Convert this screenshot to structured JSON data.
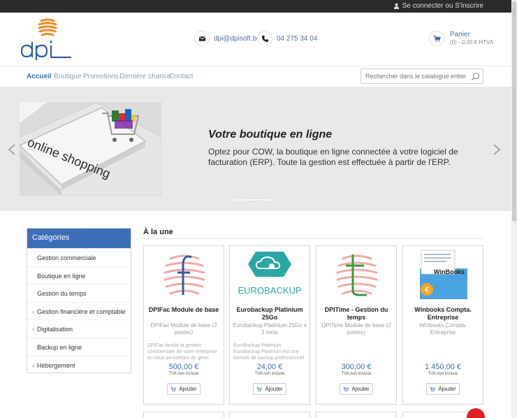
{
  "topbar": {
    "login_label": "Se connecter ou S'inscrire"
  },
  "header": {
    "logo_text": "dpi",
    "email": "dpi@dpisoft.be",
    "phone": "04 275 34 04",
    "cart_label": "Panier",
    "cart_summary": "(0) - 0,00 € HTVA"
  },
  "nav": {
    "items": [
      "Accueil",
      "Boutique",
      "Promotions",
      "Dernière chance",
      "Contact"
    ],
    "search_placeholder": "Rechercher dans le catalogue entier"
  },
  "hero": {
    "title": "Votre boutique en ligne",
    "text": "Optez pour COW, la boutique en ligne connectée à votre logiciel de facturation (ERP). Toute la gestion est effectuée à partir de l'ERP.",
    "image_text": "online shopping"
  },
  "sidebar": {
    "title": "Catégories",
    "items": [
      {
        "label": "Gestion commerciale",
        "expandable": false
      },
      {
        "label": "Boutique en ligne",
        "expandable": false
      },
      {
        "label": "Gestion du temps",
        "expandable": false
      },
      {
        "label": "Gestion financière et comptable",
        "expandable": true
      },
      {
        "label": "Digitalisation",
        "expandable": true
      },
      {
        "label": "Backup en ligne",
        "expandable": false
      },
      {
        "label": "Hébergement",
        "expandable": true
      }
    ]
  },
  "featured": {
    "title": "À la une",
    "add_label": "Ajouter",
    "tva_label": "TVA non incluse",
    "products": [
      {
        "name": "DPIFac Module de base",
        "subtitle": "DPIFac Module de base (2 postes)",
        "description": "DPIFac facilite la gestion commerciale de votre entreprise en vous permettant de gérer l'ensemble du...",
        "price": "500,00 €"
      },
      {
        "name": "Eurobackup Platinium 25Go",
        "subtitle": "Eurobackup Platinium 25Go x 1 mois",
        "description": "EuroBackup Platinium EuroBackup Platinium est une formule de backup professionnel et complet pour",
        "price": "24,00 €",
        "logo_text": "EUROBACKUP"
      },
      {
        "name": "DPITime - Gestion du temps",
        "subtitle": "DPITime Module de base (2 postes)",
        "description": "",
        "price": "300,00 €"
      },
      {
        "name": "Winbooks Compta. Entreprise",
        "subtitle": "Winbooks Compta. Entreprise",
        "description": "",
        "price": "1 450,00 €",
        "logo_text": "WinBooks"
      }
    ]
  },
  "colors": {
    "accent": "#3d6db5",
    "topbar": "#2a2a2a",
    "hero_bg": "#e9e9e9",
    "logo_orange": "#f08a24"
  }
}
